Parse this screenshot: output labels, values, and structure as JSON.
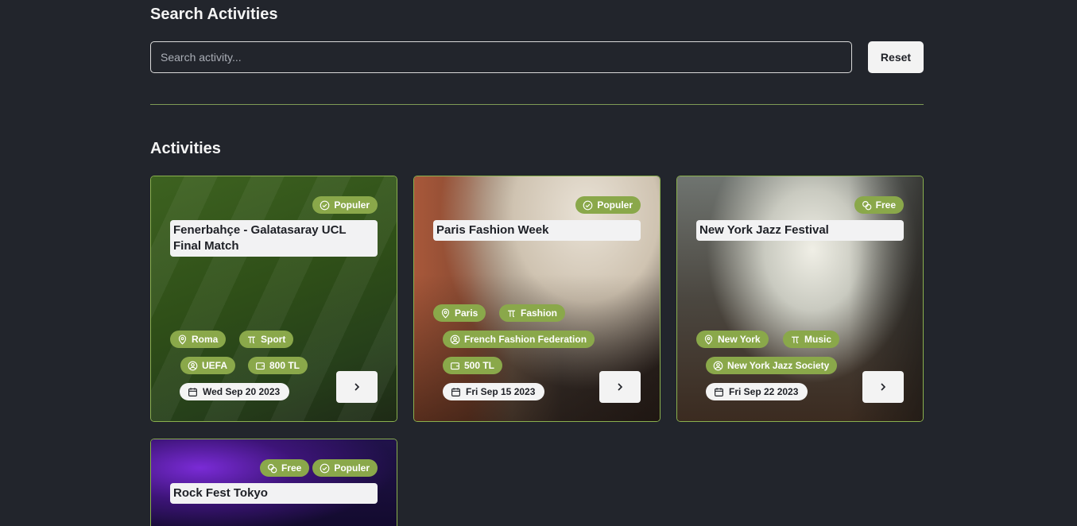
{
  "search": {
    "title": "Search Activities",
    "placeholder": "Search activity...",
    "value": "",
    "reset_label": "Reset"
  },
  "activities": {
    "title": "Activities",
    "cards": [
      {
        "title": "Fenerbahçe - Galatasaray UCL Final Match",
        "badges": [
          "Populer"
        ],
        "location": "Roma",
        "category": "Sport",
        "organizer": "UEFA",
        "price": "800 TL",
        "date": "Wed Sep 20 2023"
      },
      {
        "title": "Paris Fashion Week",
        "badges": [
          "Populer"
        ],
        "location": "Paris",
        "category": "Fashion",
        "organizer": "French Fashion Federation",
        "price": "500 TL",
        "date": "Fri Sep 15 2023"
      },
      {
        "title": "New York Jazz Festival",
        "badges": [
          "Free"
        ],
        "location": "New York",
        "category": "Music",
        "organizer": "New York Jazz Society",
        "price": "",
        "date": "Fri Sep 22 2023"
      },
      {
        "title": "Rock Fest Tokyo",
        "badges": [
          "Free",
          "Populer"
        ]
      }
    ]
  },
  "colors": {
    "background": "#22252c",
    "accent": "#8aa84a",
    "card_border": "#8ab04e",
    "divider": "#7f9a55"
  }
}
